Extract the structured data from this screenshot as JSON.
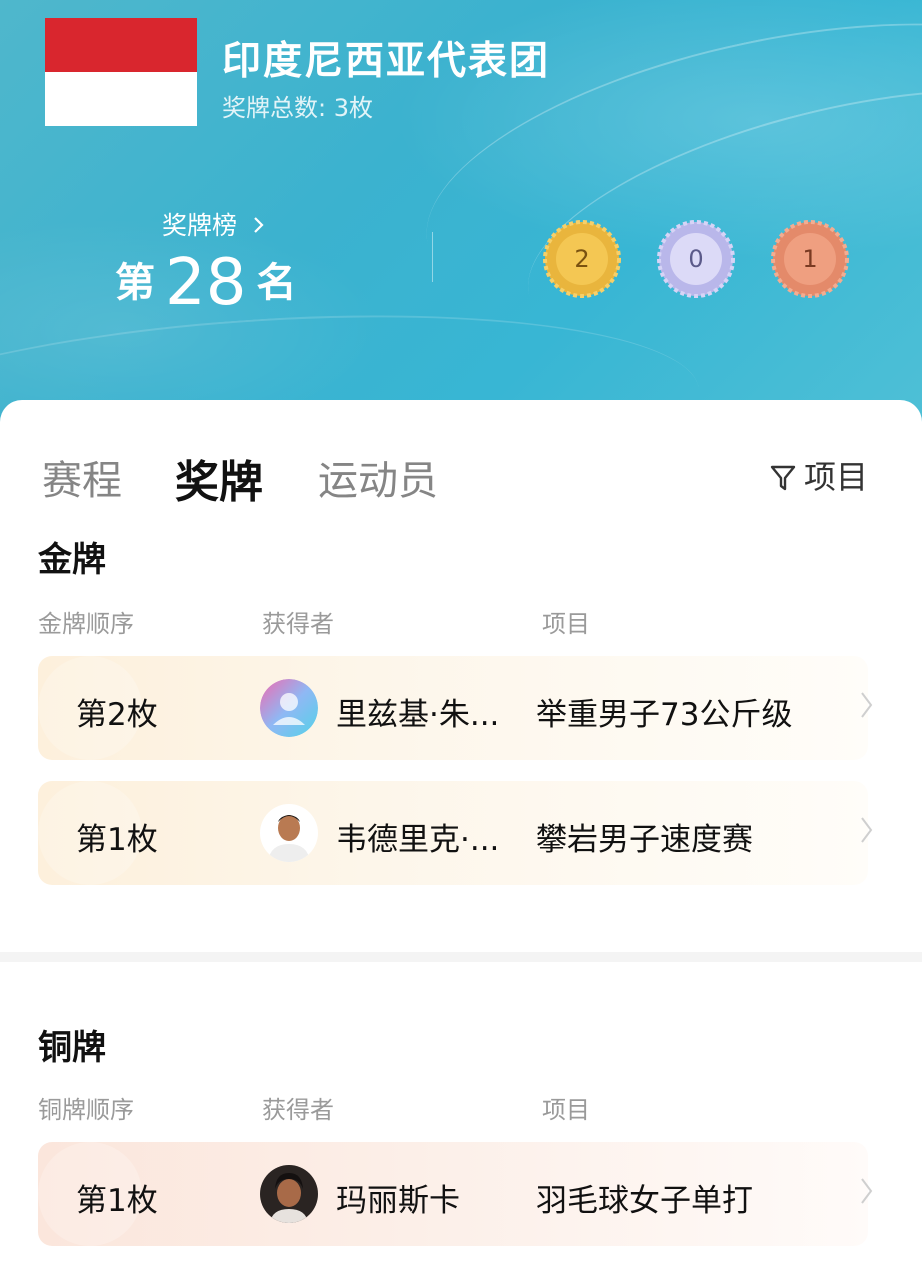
{
  "header": {
    "team_name": "印度尼西亚代表团",
    "medal_total": "奖牌总数: 3枚",
    "flag_colors": [
      "#d9262e",
      "#ffffff"
    ]
  },
  "ranking": {
    "link_label": "奖牌榜",
    "prefix": "第",
    "rank": "28",
    "suffix": "名"
  },
  "medals": {
    "gold": {
      "count": "2",
      "color": "#e9b53d"
    },
    "silver": {
      "count": "0",
      "color": "#b9b7ea"
    },
    "bronze": {
      "count": "1",
      "color": "#e48a6a"
    }
  },
  "tabs": [
    {
      "label": "赛程",
      "active": false
    },
    {
      "label": "奖牌",
      "active": true
    },
    {
      "label": "运动员",
      "active": false
    }
  ],
  "filter": {
    "label": "项目",
    "icon": "funnel-icon"
  },
  "gold_section": {
    "title": "金牌",
    "headers": [
      "金牌顺序",
      "获得者",
      "项目"
    ],
    "rows": [
      {
        "order": "第2枚",
        "winner": "里兹基·朱...",
        "event": "举重男子73公斤级",
        "avatar": "placeholder-avatar"
      },
      {
        "order": "第1枚",
        "winner": "韦德里克·...",
        "event": "攀岩男子速度赛",
        "avatar": "athlete-photo"
      }
    ]
  },
  "bronze_section": {
    "title": "铜牌",
    "headers": [
      "铜牌顺序",
      "获得者",
      "项目"
    ],
    "rows": [
      {
        "order": "第1枚",
        "winner": "玛丽斯卡",
        "event": "羽毛球女子单打",
        "avatar": "athlete-photo"
      }
    ]
  }
}
